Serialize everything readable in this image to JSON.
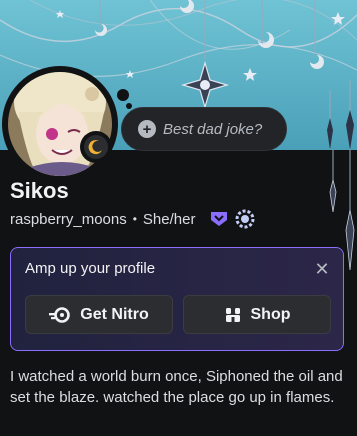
{
  "profile": {
    "display_name": "Sikos",
    "username": "raspberry_moons",
    "separator": "•",
    "pronouns": "She/her",
    "custom_status_placeholder": "Best dad joke?",
    "bio": "I watched a world burn once, Siphoned the oil and set the blaze. watched the place go up in flames."
  },
  "nitro_promo": {
    "title": "Amp up your profile",
    "close_symbol": "✕",
    "get_nitro_label": "Get Nitro",
    "shop_label": "Shop"
  },
  "icons": {
    "status": "moon-icon",
    "add_status": "plus-circle-icon",
    "badges": [
      "nitro-badge-icon",
      "boost-badge-icon"
    ]
  },
  "colors": {
    "banner": "#5fb3c7",
    "background": "#111214",
    "nitro_border": "#8b6dff",
    "status_moon": "#f0b232"
  }
}
